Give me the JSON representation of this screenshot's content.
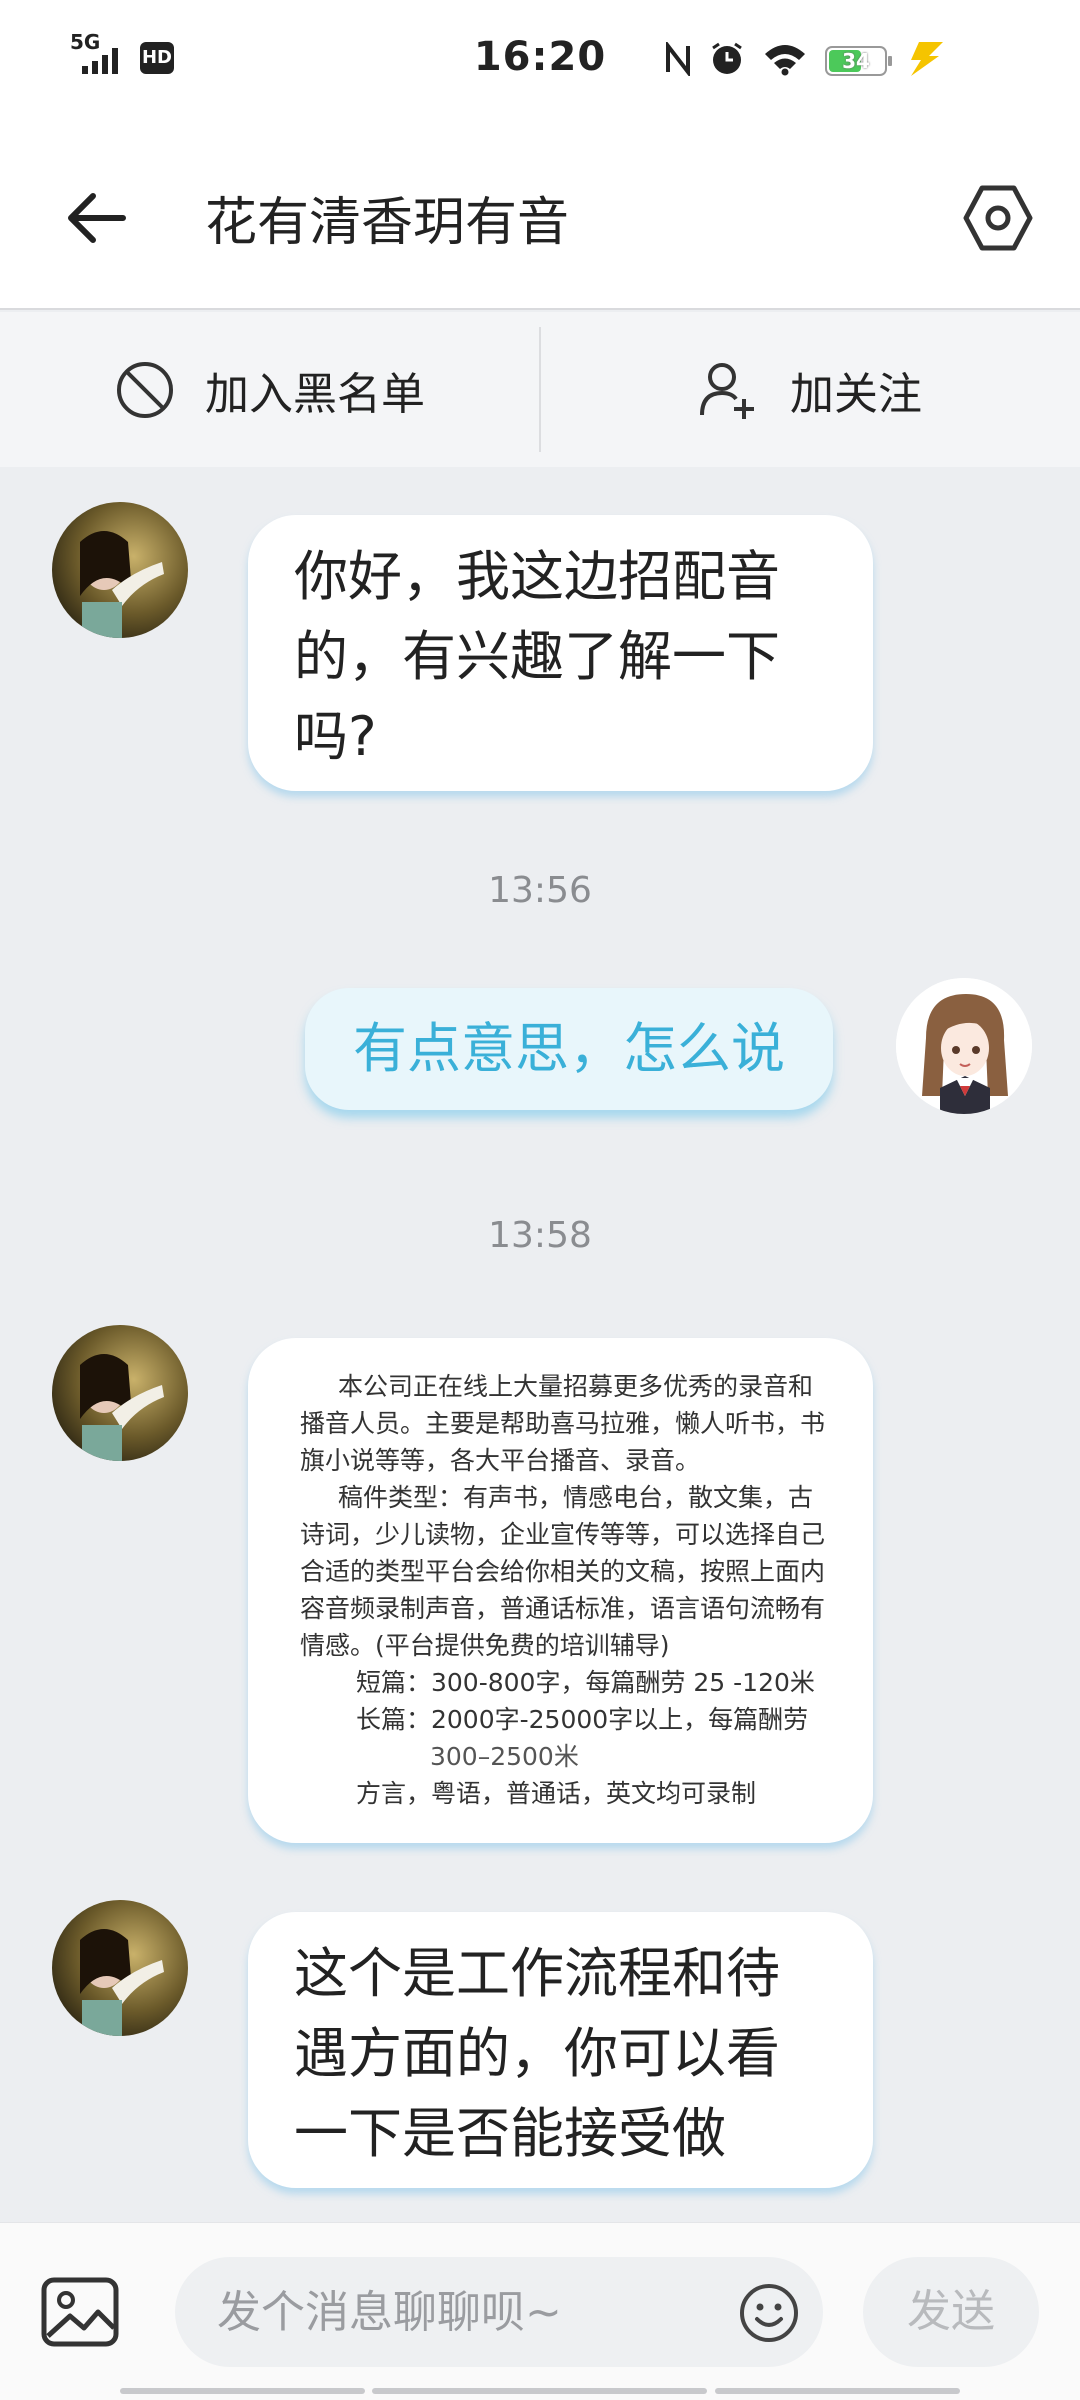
{
  "status_bar": {
    "network": "5G",
    "hd": "HD",
    "time": "16:20",
    "battery": "34",
    "battery_level": 0.34,
    "battery_color": "#4cc95a"
  },
  "header": {
    "title": "花有清香玥有音"
  },
  "actions": {
    "block_label": "加入黑名单",
    "follow_label": "加关注"
  },
  "messages": {
    "m1": "你好，我这边招配音的，有兴趣了解一下吗?",
    "t1": "13:56",
    "m2": "有点意思，怎么说",
    "t2": "13:58",
    "doc": {
      "p1": "本公司正在线上大量招募更多优秀的录音和播音人员。主要是帮助喜马拉雅，懒人听书，书旗小说等等，各大平台播音、录音。",
      "p2": "稿件类型：有声书，情感电台，散文集，古诗词，少儿读物，企业宣传等等，可以选择自己合适的类型平台会给你相关的文稿，按照上面内容音频录制声音，普通话标准，语言语句流畅有情感。(平台提供免费的培训辅导)",
      "p3": "短篇：300-800字，每篇酬劳 25 -120米",
      "p4": "长篇：2000字-25000字以上，每篇酬劳",
      "p5": "300–2500米",
      "p6": "方言，粤语，普通话，英文均可录制"
    },
    "m3": "这个是工作流程和待遇方面的，你可以看一下是否能接受做"
  },
  "input": {
    "placeholder": "发个消息聊聊呗~",
    "send_label": "发送"
  },
  "colors": {
    "accent": "#3ab0d8",
    "chat_bg": "#eceef1"
  }
}
